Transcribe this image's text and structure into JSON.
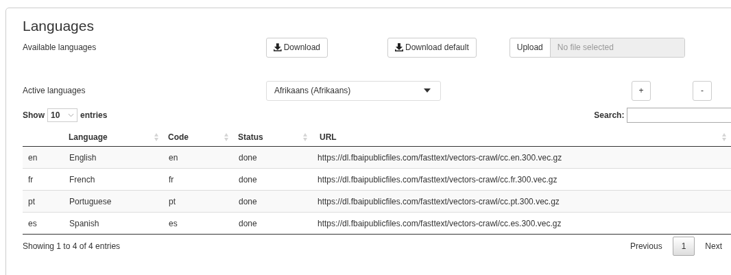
{
  "title": "Languages",
  "available": {
    "label": "Available languages",
    "buttons": [
      {
        "label": "Download"
      },
      {
        "label": "Download default"
      }
    ],
    "upload": {
      "button": "Upload",
      "placeholder": "No file selected"
    }
  },
  "active": {
    "label": "Active languages",
    "select_value": "Afrikaans (Afrikaans)",
    "add": "+",
    "remove": "-"
  },
  "length": {
    "show": "Show",
    "value": "10",
    "entries": "entries"
  },
  "search": {
    "label": "Search:"
  },
  "table": {
    "columns": [
      "",
      "Language",
      "Code",
      "Status",
      "URL"
    ],
    "rows": [
      [
        "en",
        "English",
        "en",
        "done",
        "https://dl.fbaipublicfiles.com/fasttext/vectors-crawl/cc.en.300.vec.gz"
      ],
      [
        "fr",
        "French",
        "fr",
        "done",
        "https://dl.fbaipublicfiles.com/fasttext/vectors-crawl/cc.fr.300.vec.gz"
      ],
      [
        "pt",
        "Portuguese",
        "pt",
        "done",
        "https://dl.fbaipublicfiles.com/fasttext/vectors-crawl/cc.pt.300.vec.gz"
      ],
      [
        "es",
        "Spanish",
        "es",
        "done",
        "https://dl.fbaipublicfiles.com/fasttext/vectors-crawl/cc.es.300.vec.gz"
      ]
    ]
  },
  "info": "Showing 1 to 4 of 4 entries",
  "pagination": {
    "previous": "Previous",
    "pages": [
      {
        "label": "1",
        "selected": true
      }
    ],
    "next": "Next"
  }
}
